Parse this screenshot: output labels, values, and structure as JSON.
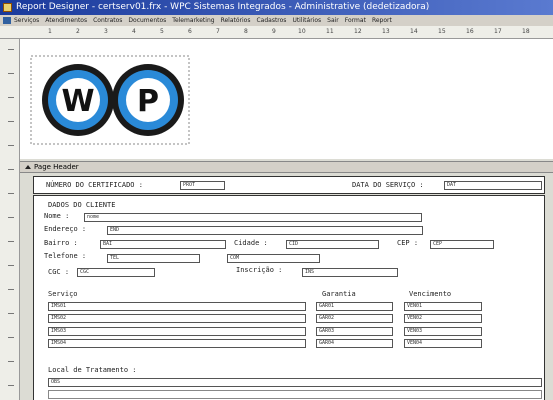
{
  "window": {
    "title": "Report Designer - certserv01.frx - WPC Sistemas Integrados - Administrative (dedetizadora)",
    "icon": "app-icon"
  },
  "menu": {
    "icon": "report-icon",
    "items": [
      "Serviços",
      "Atendimentos",
      "Contratos",
      "Documentos",
      "Telemarketing",
      "Relatórios",
      "Cadastros",
      "Utilitários",
      "Sair",
      "Format",
      "Report"
    ]
  },
  "ruler": {
    "labels": [
      "1",
      "2",
      "3",
      "4",
      "5",
      "6",
      "7",
      "8",
      "9",
      "10",
      "11",
      "12",
      "13",
      "14",
      "15",
      "16",
      "17",
      "18"
    ]
  },
  "band": {
    "label": "Page Header"
  },
  "logo": {
    "left_letter": "W",
    "right_letter": "P"
  },
  "certificate": {
    "number_label": "NÚMERO DO CERTIFICADO :",
    "number_field": "PROT",
    "date_label": "DATA DO SERVIÇO :",
    "date_field": "DAT"
  },
  "client": {
    "section_title": "DADOS DO CLIENTE",
    "nome_label": "Nome :",
    "nome_field": "nome",
    "endereco_label": "Endereço :",
    "endereco_field": "END",
    "bairro_label": "Bairro :",
    "bairro_field": "BAI",
    "cidade_label": "Cidade :",
    "cidade_field": "CID",
    "cep_label": "CEP :",
    "cep_field": "CEP",
    "telefone_label": "Telefone :",
    "telefone_field": "TEL",
    "telefone_field2": "COM",
    "cgc_label": "CGC :",
    "cgc_field": "CGC",
    "inscricao_label": "Inscrição :",
    "inscricao_field": "INS"
  },
  "services": {
    "servico_label": "Serviço",
    "garantia_label": "Garantia",
    "vencimento_label": "Vencimento",
    "rows": [
      {
        "servico": "IMS01",
        "garantia": "GAR01",
        "vencimento": "VEN01"
      },
      {
        "servico": "IMS02",
        "garantia": "GAR02",
        "vencimento": "VEN02"
      },
      {
        "servico": "IMS03",
        "garantia": "GAR03",
        "vencimento": "VEN03"
      },
      {
        "servico": "IMS04",
        "garantia": "GAR04",
        "vencimento": "VEN04"
      }
    ]
  },
  "treatment": {
    "label": "Local de Tratamento :",
    "field": "OBS"
  }
}
